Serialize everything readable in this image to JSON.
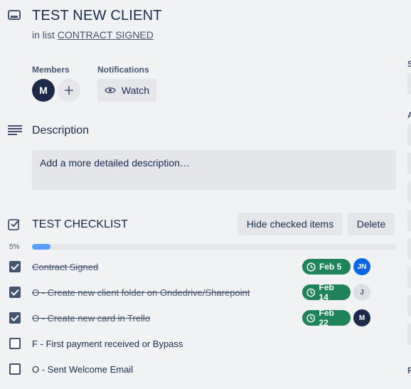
{
  "card": {
    "title": "TEST NEW CLIENT",
    "in_list_prefix": "in list",
    "list_name": "CONTRACT SIGNED"
  },
  "members": {
    "label": "Members",
    "avatar_initial": "M"
  },
  "notifications": {
    "label": "Notifications",
    "watch_label": "Watch"
  },
  "description": {
    "heading": "Description",
    "placeholder": "Add a more detailed description…"
  },
  "checklist": {
    "title": "TEST CHECKLIST",
    "hide_checked_label": "Hide checked items",
    "delete_label": "Delete",
    "progress_percent": 5,
    "progress_label": "5%",
    "items": [
      {
        "text": "Contract Signed",
        "checked": true,
        "date": "Feb 5",
        "assignee": "JN"
      },
      {
        "text": "O - Create new client folder on Ondedrive/Sharepoint",
        "checked": true,
        "date": "Feb 14",
        "assignee": "J"
      },
      {
        "text": "O - Create new card in Trello",
        "checked": true,
        "date": "Feb 22",
        "assignee": "M"
      },
      {
        "text": "F - First payment received or Bypass",
        "checked": false
      },
      {
        "text": "O - Sent Welcome Email",
        "checked": false
      }
    ]
  },
  "right_panel": {
    "label_s": "S",
    "label_a": "A",
    "label_p": "P"
  },
  "colors": {
    "accent": "#579dff",
    "date_badge": "#1f845a",
    "avatar_dark": "#1d2a4a",
    "avatar_blue": "#0c66e4"
  }
}
